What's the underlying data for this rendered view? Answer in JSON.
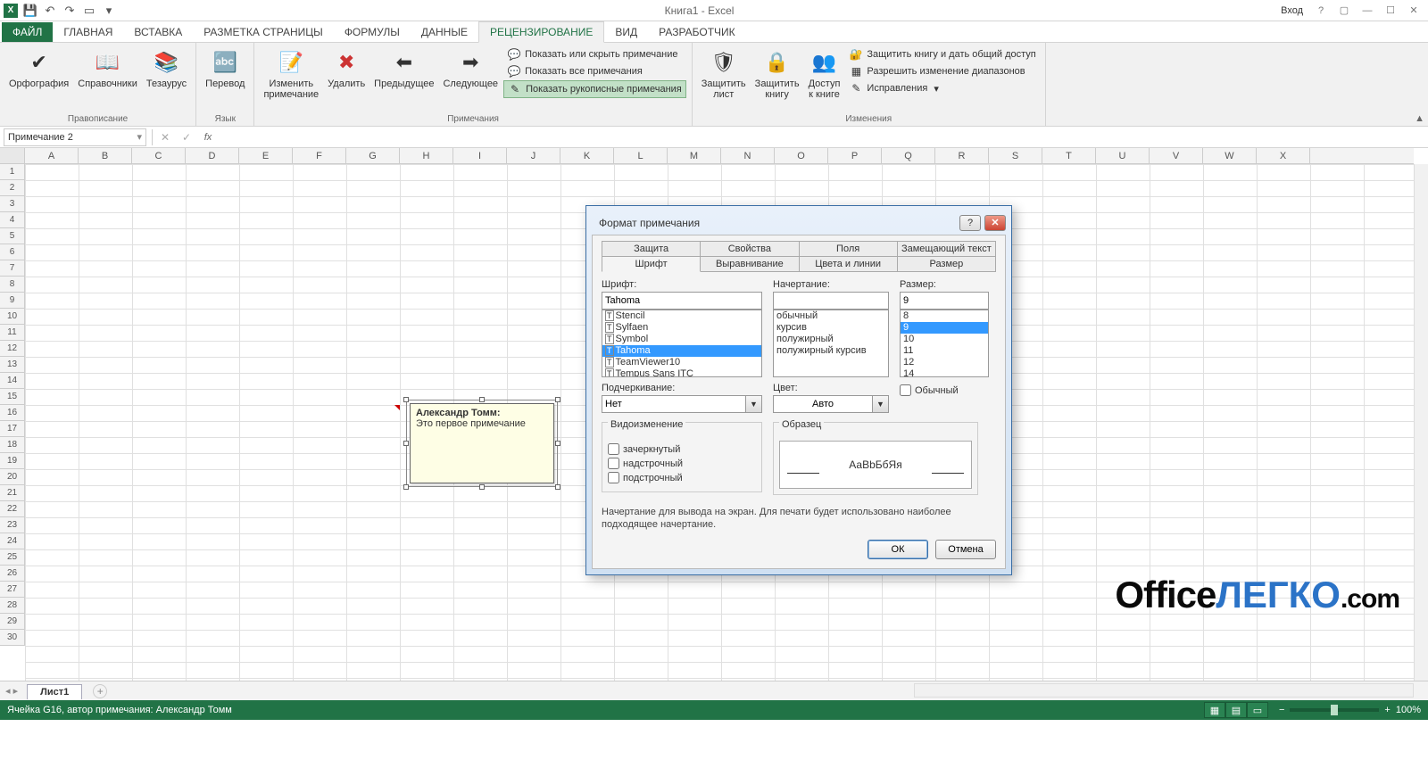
{
  "app": {
    "title": "Книга1 - Excel",
    "login": "Вход"
  },
  "qat": [
    "save",
    "undo",
    "redo",
    "touch",
    "customize"
  ],
  "tabs": {
    "file": "ФАЙЛ",
    "items": [
      "ГЛАВНАЯ",
      "ВСТАВКА",
      "РАЗМЕТКА СТРАНИЦЫ",
      "ФОРМУЛЫ",
      "ДАННЫЕ",
      "РЕЦЕНЗИРОВАНИЕ",
      "ВИД",
      "РАЗРАБОТЧИК"
    ],
    "active": 5
  },
  "ribbon": {
    "groups": {
      "proofing": {
        "label": "Правописание",
        "spell": "Орфография",
        "research": "Справочники",
        "thesaurus": "Тезаурус"
      },
      "lang": {
        "label": "Язык",
        "translate": "Перевод"
      },
      "comments": {
        "label": "Примечания",
        "edit": "Изменить\nпримечание",
        "del": "Удалить",
        "prev": "Предыдущее",
        "next": "Следующее",
        "showhide": "Показать или скрыть примечание",
        "showall": "Показать все примечания",
        "ink": "Показать рукописные примечания"
      },
      "changes": {
        "label": "Изменения",
        "protectSheet": "Защитить\nлист",
        "protectBook": "Защитить\nкнигу",
        "share": "Доступ\nк книге",
        "protectShare": "Защитить книгу и дать общий доступ",
        "allowRanges": "Разрешить изменение диапазонов",
        "track": "Исправления"
      }
    }
  },
  "nameBox": "Примечание 2",
  "columns": [
    "A",
    "B",
    "C",
    "D",
    "E",
    "F",
    "G",
    "H",
    "I",
    "J",
    "K",
    "L",
    "M",
    "N",
    "O",
    "P",
    "Q",
    "R",
    "S",
    "T",
    "U",
    "V",
    "W",
    "X"
  ],
  "rows": 30,
  "comment": {
    "author": "Александр Томм:",
    "text": "Это первое примечание"
  },
  "dialog": {
    "title": "Формат примечания",
    "tabsTop": [
      "Защита",
      "Свойства",
      "Поля",
      "Замещающий текст"
    ],
    "tabsBot": [
      "Шрифт",
      "Выравнивание",
      "Цвета и линии",
      "Размер"
    ],
    "activeTab": "Шрифт",
    "font": {
      "label": "Шрифт:",
      "value": "Tahoma",
      "list": [
        "Stencil",
        "Sylfaen",
        "Symbol",
        "Tahoma",
        "TeamViewer10",
        "Tempus Sans ITC"
      ],
      "selected": "Tahoma"
    },
    "style": {
      "label": "Начертание:",
      "value": "",
      "list": [
        "обычный",
        "курсив",
        "полужирный",
        "полужирный курсив"
      ],
      "selected": ""
    },
    "size": {
      "label": "Размер:",
      "value": "9",
      "list": [
        "8",
        "9",
        "10",
        "11",
        "12",
        "14"
      ],
      "selected": "9"
    },
    "underline": {
      "label": "Подчеркивание:",
      "value": "Нет"
    },
    "color": {
      "label": "Цвет:",
      "value": "Авто"
    },
    "normal": {
      "label": "Обычный"
    },
    "effects": {
      "label": "Видоизменение",
      "strike": "зачеркнутый",
      "super": "надстрочный",
      "sub": "подстрочный"
    },
    "sample": {
      "label": "Образец",
      "text": "АаBbБбЯя"
    },
    "hint": "Начертание для вывода на экран. Для печати будет использовано наиболее подходящее начертание.",
    "ok": "ОК",
    "cancel": "Отмена"
  },
  "sheetTabs": {
    "active": "Лист1"
  },
  "statusbar": {
    "text": "Ячейка G16, автор примечания: Александр Томм",
    "zoom": "100%"
  },
  "watermark": {
    "p1": "Office",
    "p2": "ЛЕГКО",
    "p3": ".com"
  }
}
